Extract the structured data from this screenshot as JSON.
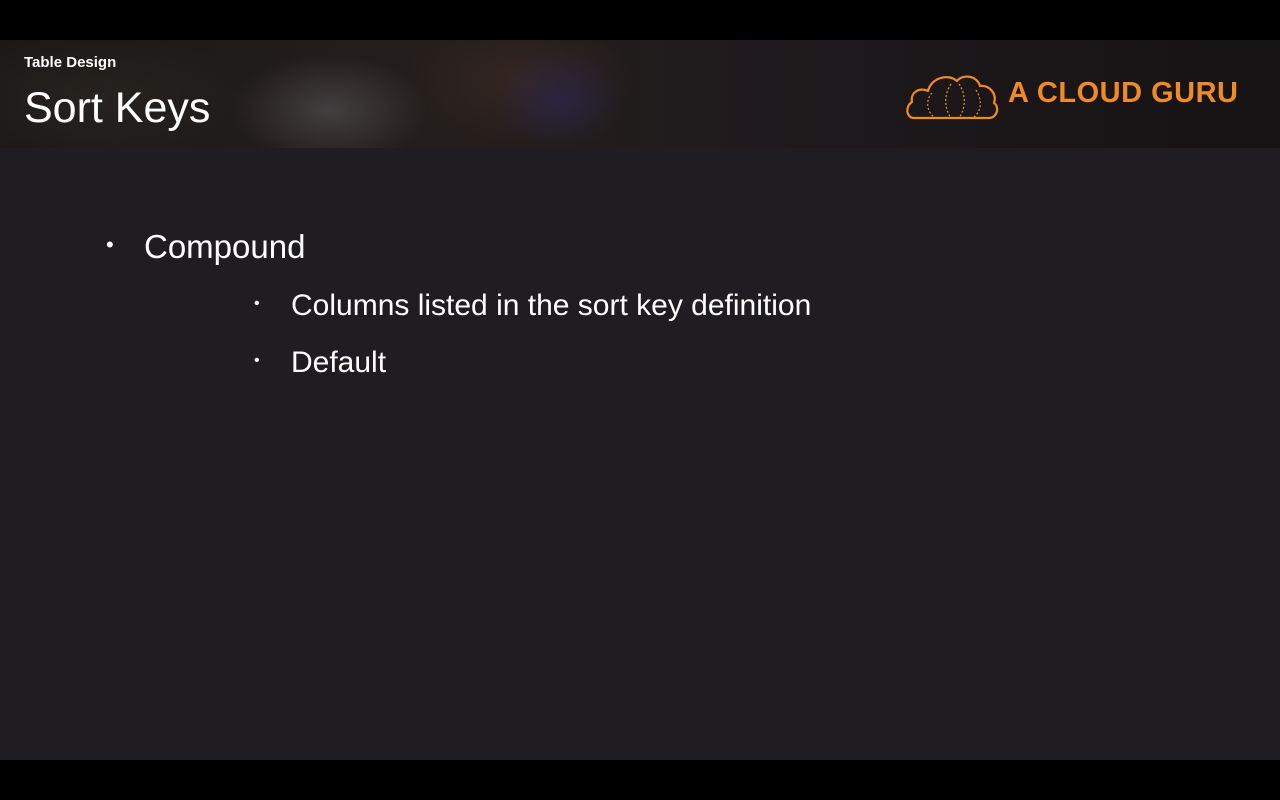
{
  "header": {
    "section_label": "Table Design",
    "title": "Sort Keys"
  },
  "logo": {
    "text": "A CLOUD GURU",
    "icon": "cloud-icon",
    "color": "#f08a24"
  },
  "bullets": [
    {
      "label": "Compound",
      "children": [
        {
          "label": "Columns listed in the sort key definition"
        },
        {
          "label": "Default"
        }
      ]
    }
  ],
  "colors": {
    "background": "#1f1d21",
    "letterbox": "#000000",
    "text": "#ffffff",
    "accent": "#f08a24"
  }
}
